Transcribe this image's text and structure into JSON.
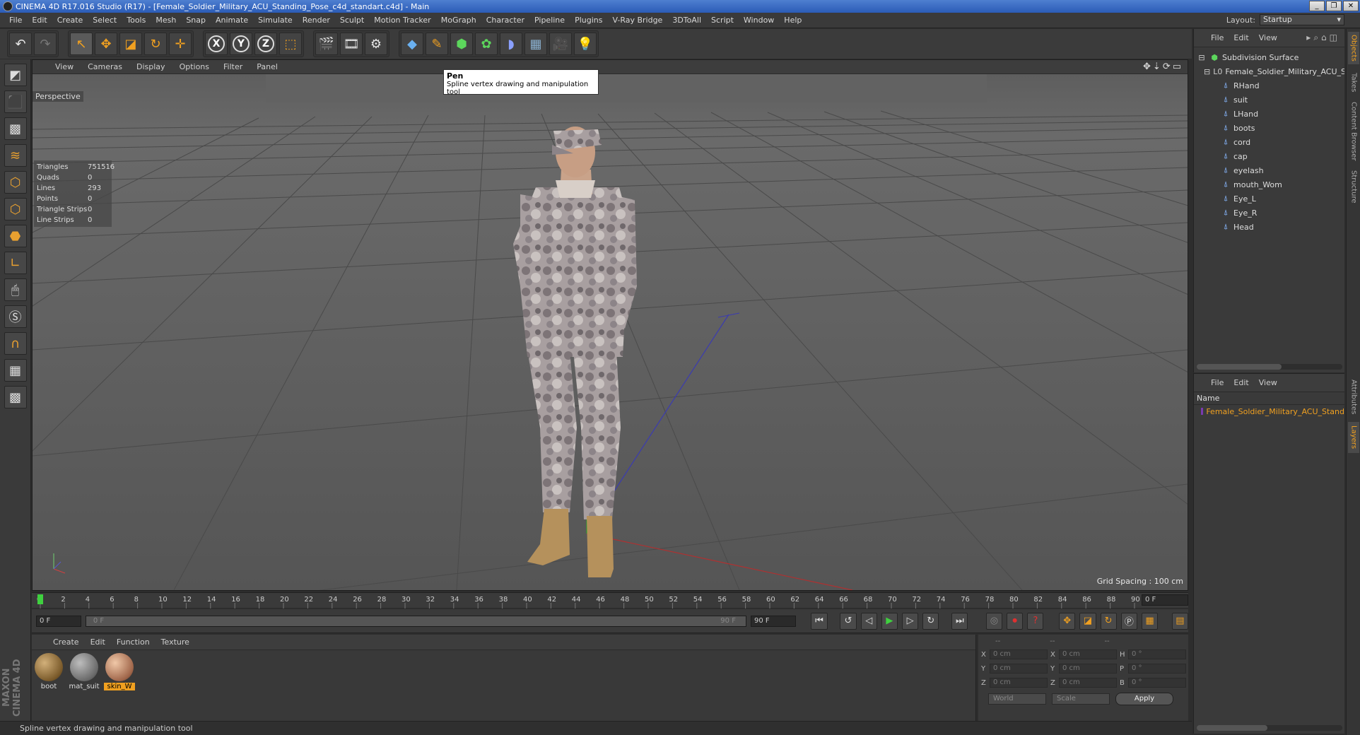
{
  "title": "CINEMA 4D R17.016 Studio (R17) - [Female_Soldier_Military_ACU_Standing_Pose_c4d_standart.c4d] - Main",
  "window_buttons": [
    "_",
    "❐",
    "✕"
  ],
  "menu": [
    "File",
    "Edit",
    "Create",
    "Select",
    "Tools",
    "Mesh",
    "Snap",
    "Animate",
    "Simulate",
    "Render",
    "Sculpt",
    "Motion Tracker",
    "MoGraph",
    "Character",
    "Pipeline",
    "Plugins",
    "V-Ray Bridge",
    "3DToAll",
    "Script",
    "Window",
    "Help"
  ],
  "layout": {
    "label": "Layout:",
    "value": "Startup"
  },
  "viewport": {
    "menu": [
      "View",
      "Cameras",
      "Display",
      "Options",
      "Filter",
      "Panel"
    ],
    "label": "Perspective",
    "grid_spacing": "Grid Spacing : 100 cm",
    "stats": [
      {
        "name": "Triangles",
        "value": "751516"
      },
      {
        "name": "Quads",
        "value": "0"
      },
      {
        "name": "Lines",
        "value": "293"
      },
      {
        "name": "Points",
        "value": "0"
      },
      {
        "name": "Triangle Strips",
        "value": "0"
      },
      {
        "name": "Line Strips",
        "value": "0"
      }
    ]
  },
  "tooltip": {
    "title": "Pen",
    "text": "Spline vertex drawing and manipulation tool"
  },
  "timeline": {
    "ticks": [
      "0",
      "2",
      "4",
      "6",
      "8",
      "10",
      "12",
      "14",
      "16",
      "18",
      "20",
      "22",
      "24",
      "26",
      "28",
      "30",
      "32",
      "34",
      "36",
      "38",
      "40",
      "42",
      "44",
      "46",
      "48",
      "50",
      "52",
      "54",
      "56",
      "58",
      "60",
      "62",
      "64",
      "66",
      "68",
      "70",
      "72",
      "74",
      "76",
      "78",
      "80",
      "82",
      "84",
      "86",
      "88",
      "90"
    ],
    "current_frame": "0 F"
  },
  "transport": {
    "start": "0 F",
    "range_start": "0 F",
    "range_end": "90 F",
    "end": "90 F"
  },
  "materials": {
    "menu": [
      "Create",
      "Edit",
      "Function",
      "Texture"
    ],
    "items": [
      {
        "name": "boot",
        "color": "#8a6a3a",
        "selected": false
      },
      {
        "name": "mat_suit",
        "color": "#7a7a7a",
        "selected": false
      },
      {
        "name": "skin_W",
        "color": "#b07a5a",
        "selected": true
      }
    ]
  },
  "coords": {
    "headers": [
      "--",
      "--",
      "--"
    ],
    "rows": [
      {
        "a": "X",
        "av": "0 cm",
        "b": "X",
        "bv": "0 cm",
        "c": "H",
        "cv": "0 °"
      },
      {
        "a": "Y",
        "av": "0 cm",
        "b": "Y",
        "bv": "0 cm",
        "c": "P",
        "cv": "0 °"
      },
      {
        "a": "Z",
        "av": "0 cm",
        "b": "Z",
        "bv": "0 cm",
        "c": "B",
        "cv": "0 °"
      }
    ],
    "world": "World",
    "scale": "Scale",
    "apply": "Apply"
  },
  "status": "Spline vertex drawing and manipulation tool",
  "branding": "MAXON CINEMA 4D",
  "objects": {
    "menu": [
      "File",
      "Edit",
      "View"
    ],
    "root": "Subdivision Surface",
    "group": "Female_Soldier_Military_ACU_Stan",
    "children": [
      "RHand",
      "suit",
      "LHand",
      "boots",
      "cord",
      "cap",
      "eyelash",
      "mouth_Wom",
      "Eye_L",
      "Eye_R",
      "Head"
    ]
  },
  "layers": {
    "menu": [
      "File",
      "Edit",
      "View"
    ],
    "column": "Name",
    "items": [
      "Female_Soldier_Military_ACU_Stand"
    ]
  },
  "right_tabs": [
    "Objects",
    "Takes",
    "Content Browser",
    "Structure",
    "Attributes",
    "Layers"
  ]
}
